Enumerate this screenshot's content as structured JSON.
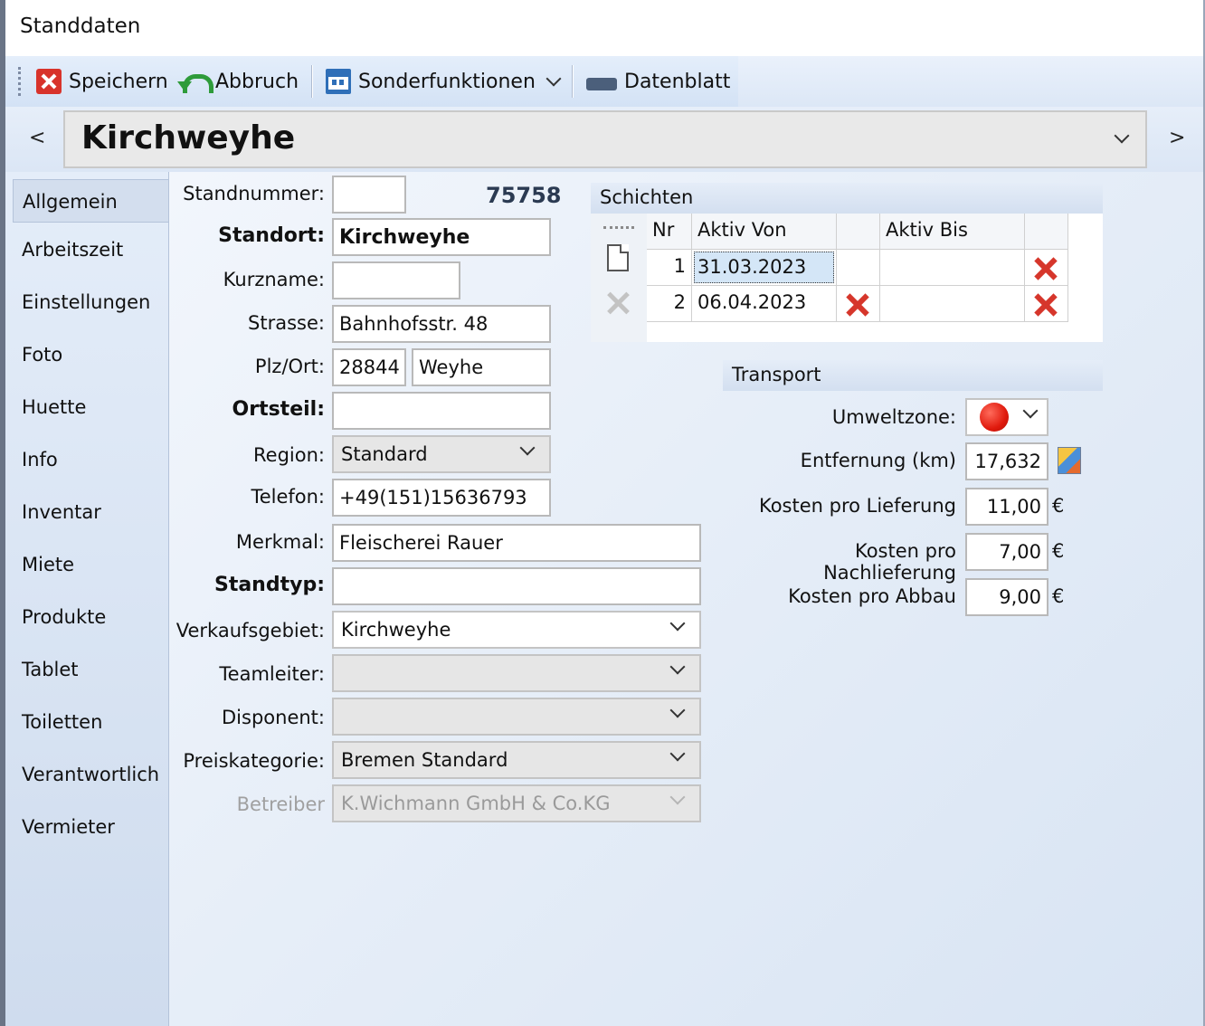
{
  "window": {
    "title": "Standdaten"
  },
  "toolbar": {
    "save_label": "Speichern",
    "cancel_label": "Abbruch",
    "special_label": "Sonderfunktionen",
    "datasheet_label": "Datenblatt"
  },
  "nav": {
    "prev": "<",
    "next": ">",
    "current": "Kirchweyhe"
  },
  "sidebar": {
    "items": [
      {
        "label": "Allgemein",
        "active": true
      },
      {
        "label": "Arbeitszeit"
      },
      {
        "label": "Einstellungen"
      },
      {
        "label": "Foto"
      },
      {
        "label": "Huette"
      },
      {
        "label": "Info"
      },
      {
        "label": "Inventar"
      },
      {
        "label": "Miete"
      },
      {
        "label": "Produkte"
      },
      {
        "label": "Tablet"
      },
      {
        "label": "Toiletten"
      },
      {
        "label": "Verantwortlich"
      },
      {
        "label": "Vermieter"
      }
    ]
  },
  "form": {
    "standnummer": {
      "label": "Standnummer:",
      "value": "",
      "number": "75758"
    },
    "standort": {
      "label": "Standort:",
      "value": "Kirchweyhe"
    },
    "kurzname": {
      "label": "Kurzname:",
      "value": ""
    },
    "strasse": {
      "label": "Strasse:",
      "value": "Bahnhofsstr. 48"
    },
    "plzort": {
      "label": "Plz/Ort:",
      "plz": "28844",
      "ort": "Weyhe"
    },
    "ortsteil": {
      "label": "Ortsteil:",
      "value": ""
    },
    "region": {
      "label": "Region:",
      "value": "Standard"
    },
    "telefon": {
      "label": "Telefon:",
      "value": "+49(151)15636793"
    },
    "merkmal": {
      "label": "Merkmal:",
      "value": "Fleischerei Rauer"
    },
    "standtyp": {
      "label": "Standtyp:",
      "value": ""
    },
    "verkaufsgebiet": {
      "label": "Verkaufsgebiet:",
      "value": "Kirchweyhe"
    },
    "teamleiter": {
      "label": "Teamleiter:",
      "value": ""
    },
    "disponent": {
      "label": "Disponent:",
      "value": ""
    },
    "preiskategorie": {
      "label": "Preiskategorie:",
      "value": "Bremen Standard"
    },
    "betreiber": {
      "label": "Betreiber",
      "value": "K.Wichmann GmbH & Co.KG"
    }
  },
  "schichten": {
    "title": "Schichten",
    "columns": [
      "Nr",
      "Aktiv Von",
      "Aktiv Bis"
    ],
    "rows": [
      {
        "nr": "1",
        "von": "31.03.2023",
        "bis": ""
      },
      {
        "nr": "2",
        "von": "06.04.2023",
        "bis": ""
      }
    ]
  },
  "transport": {
    "title": "Transport",
    "umweltzone": {
      "label": "Umweltzone:",
      "color": "#e01a0d"
    },
    "entfernung": {
      "label": "Entfernung (km)",
      "value": "17,632"
    },
    "lieferung": {
      "label": "Kosten pro Lieferung",
      "value": "11,00"
    },
    "nachlieferung": {
      "label": "Kosten pro Nachlieferung",
      "value": "7,00"
    },
    "abbau": {
      "label": "Kosten pro Abbau",
      "value": "9,00"
    },
    "currency": "€"
  }
}
